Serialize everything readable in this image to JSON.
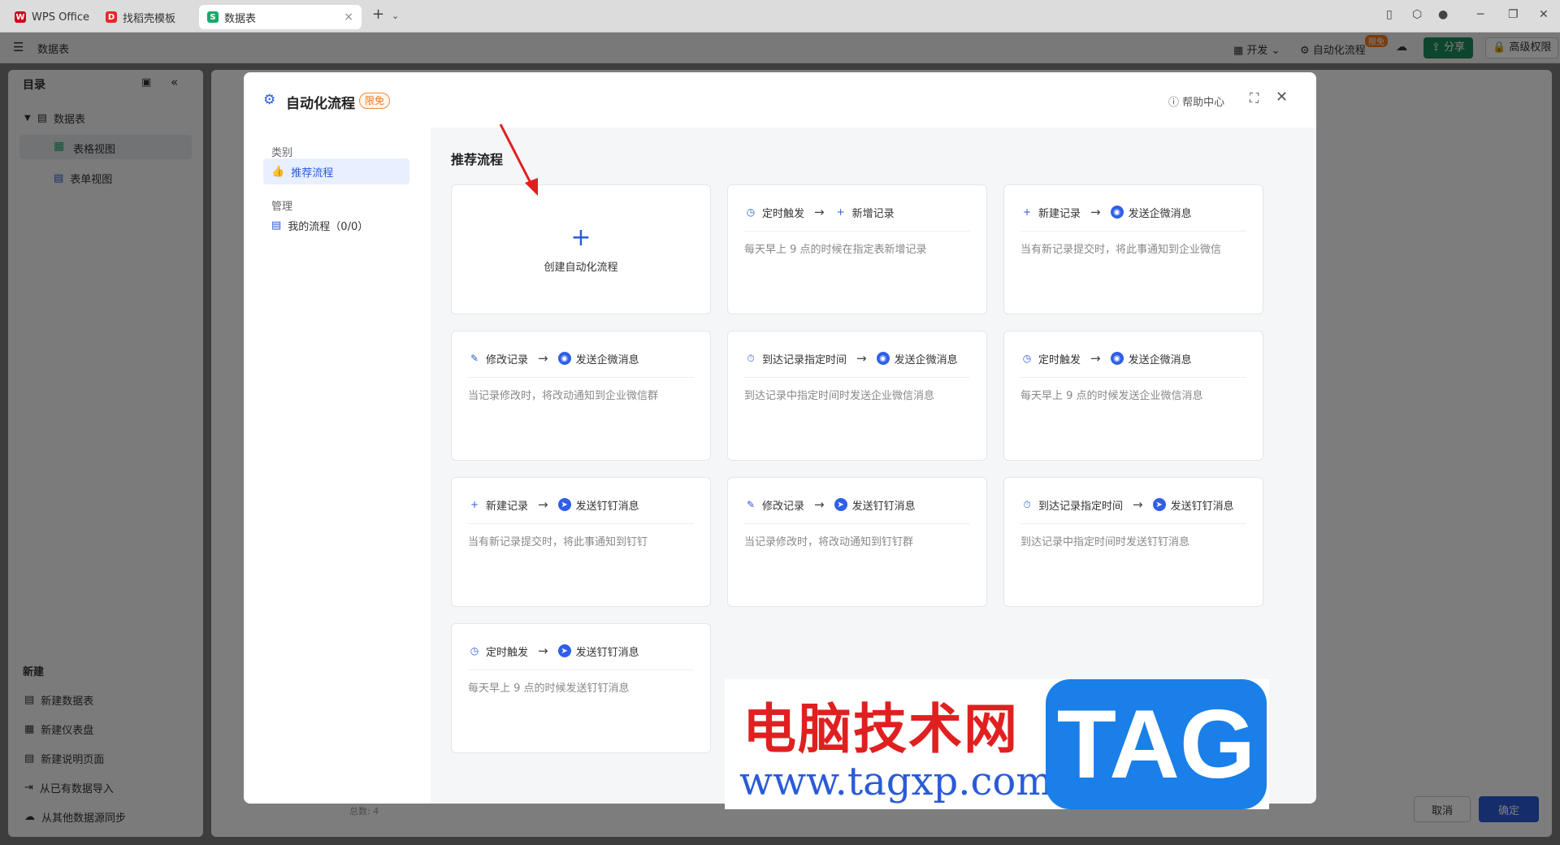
{
  "tabs": [
    {
      "label": "WPS Office",
      "color": "#d0021b",
      "icon": "W"
    },
    {
      "label": "找稻壳模板",
      "color": "#e02a2a",
      "icon": "D"
    },
    {
      "label": "数据表",
      "color": "#1aa86b",
      "icon": "S"
    }
  ],
  "toolbar": {
    "title": "数据表",
    "develop_label": "开发",
    "automation_label": "自动化流程",
    "automation_badge": "限免",
    "share_label": "分享",
    "permission_label": "高级权限"
  },
  "sidebar": {
    "title": "目录",
    "tree_root": "数据表",
    "items": [
      "表格视图",
      "表单视图"
    ],
    "new_section": "新建",
    "new_items": [
      "新建数据表",
      "新建仪表盘",
      "新建说明页面",
      "从已有数据导入",
      "从其他数据源同步"
    ]
  },
  "background": {
    "total_label": "总数: 4",
    "cancel_label": "取消",
    "confirm_label": "确定"
  },
  "modal": {
    "title": "自动化流程",
    "badge": "限免",
    "help_label": "帮助中心",
    "category_label": "类别",
    "recommended_label": "推荐流程",
    "manage_label": "管理",
    "my_flows_label": "我的流程（0/0）",
    "section_title": "推荐流程",
    "create_label": "创建自动化流程",
    "cards": [
      {
        "trigger": "定时触发",
        "trigger_icon": "clock-icon",
        "action": "新增记录",
        "action_icon": "plus-icon",
        "desc": "每天早上 9 点的时候在指定表新增记录"
      },
      {
        "trigger": "新建记录",
        "trigger_icon": "plus-icon",
        "action": "发送企微消息",
        "action_icon": "wecom-icon",
        "desc": "当有新记录提交时，将此事通知到企业微信"
      },
      {
        "trigger": "修改记录",
        "trigger_icon": "pencil-icon",
        "action": "发送企微消息",
        "action_icon": "wecom-icon",
        "desc": "当记录修改时，将改动通知到企业微信群"
      },
      {
        "trigger": "到达记录指定时间",
        "trigger_icon": "timer-icon",
        "action": "发送企微消息",
        "action_icon": "wecom-icon",
        "desc": "到达记录中指定时间时发送企业微信消息"
      },
      {
        "trigger": "定时触发",
        "trigger_icon": "clock-icon",
        "action": "发送企微消息",
        "action_icon": "wecom-icon",
        "desc": "每天早上 9 点的时候发送企业微信消息"
      },
      {
        "trigger": "新建记录",
        "trigger_icon": "plus-icon",
        "action": "发送钉钉消息",
        "action_icon": "dingtalk-icon",
        "desc": "当有新记录提交时，将此事通知到钉钉"
      },
      {
        "trigger": "修改记录",
        "trigger_icon": "pencil-icon",
        "action": "发送钉钉消息",
        "action_icon": "dingtalk-icon",
        "desc": "当记录修改时，将改动通知到钉钉群"
      },
      {
        "trigger": "到达记录指定时间",
        "trigger_icon": "timer-icon",
        "action": "发送钉钉消息",
        "action_icon": "dingtalk-icon",
        "desc": "到达记录中指定时间时发送钉钉消息"
      },
      {
        "trigger": "定时触发",
        "trigger_icon": "clock-icon",
        "action": "发送钉钉消息",
        "action_icon": "dingtalk-icon",
        "desc": "每天早上 9 点的时候发送钉钉消息"
      }
    ]
  },
  "watermark": {
    "cn": "电脑技术网",
    "url": "www.tagxp.com",
    "tag": "TAG"
  },
  "colors": {
    "accent": "#2a5bd7",
    "share": "#1a8a5c",
    "badge": "#f07a1e",
    "annotation_arrow": "#e02020"
  }
}
